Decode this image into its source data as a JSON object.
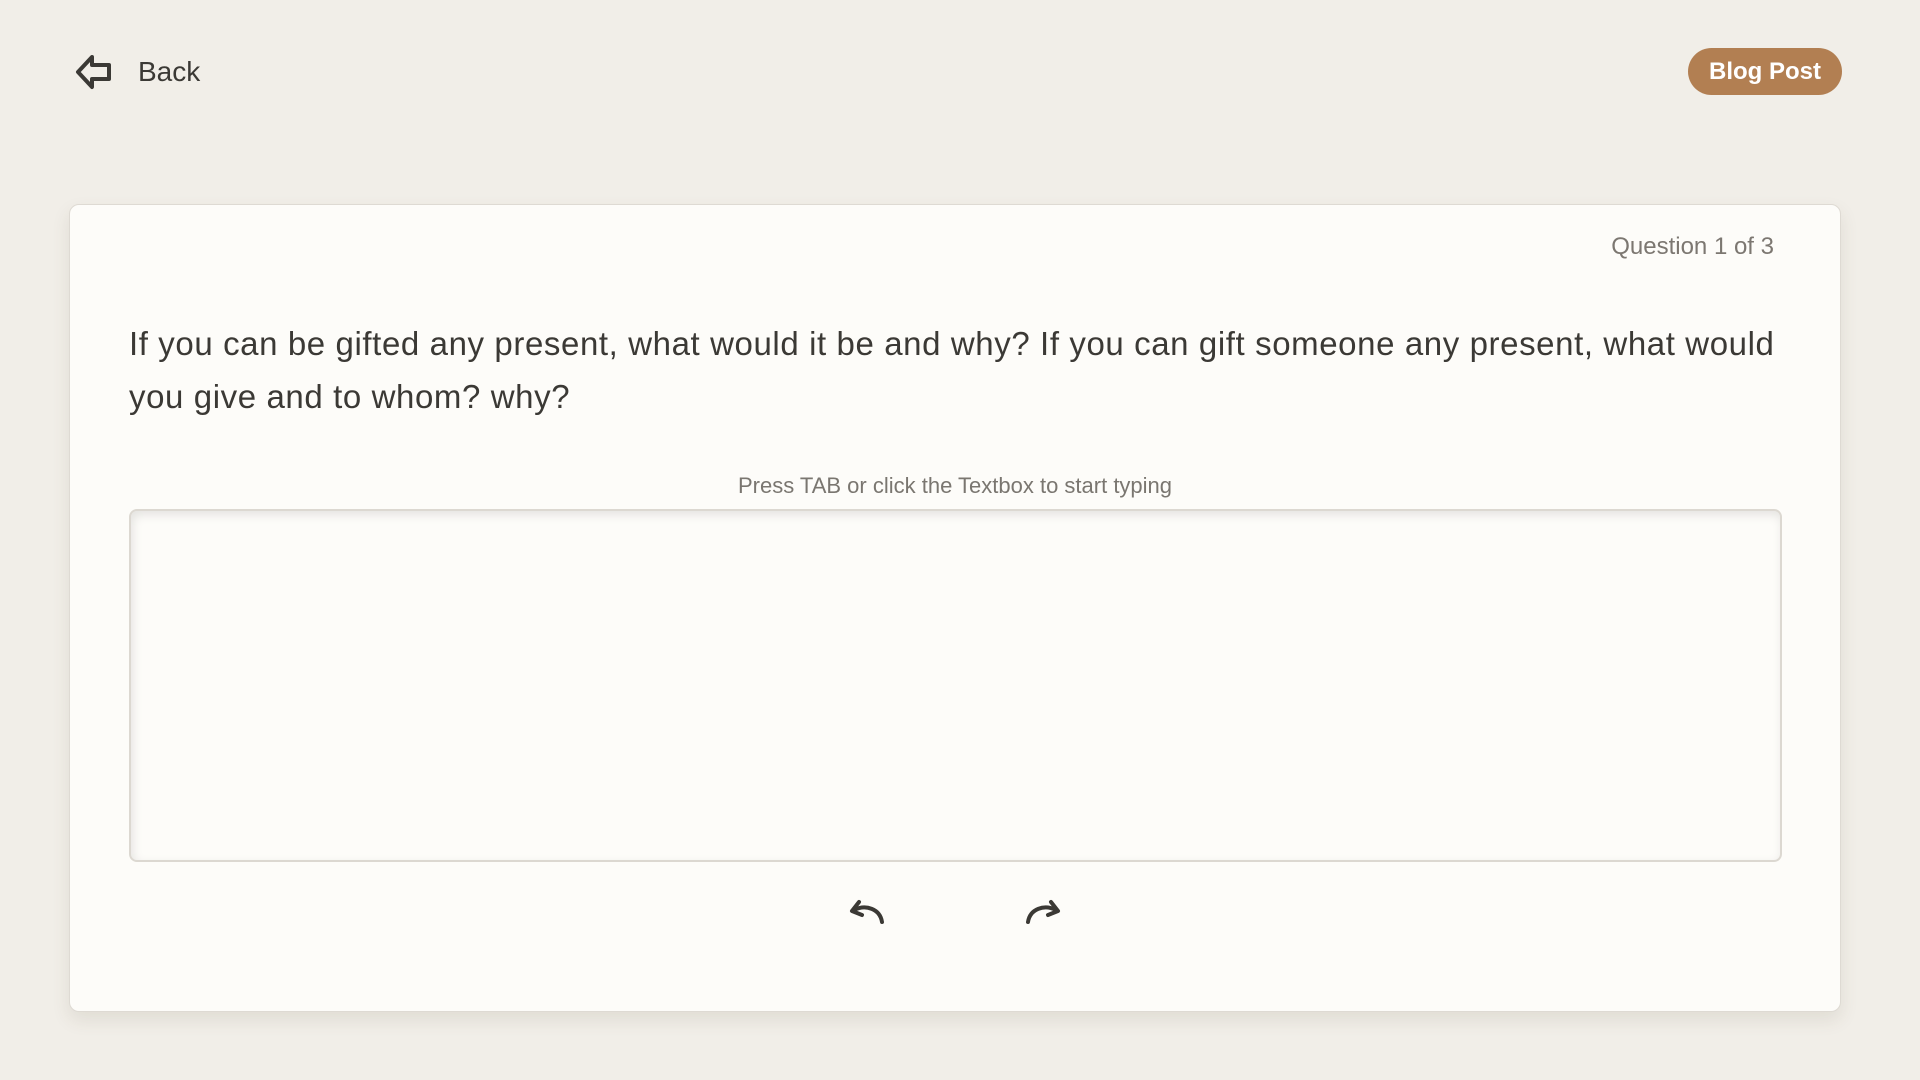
{
  "header": {
    "back_label": "Back",
    "badge_label": "Blog Post",
    "badge_color": "#b27f52"
  },
  "card": {
    "counter": "Question 1 of 3",
    "question": "If you can be gifted any present, what would it be and why? If you can gift someone any present, what would you give and to whom? why?",
    "hint": "Press TAB or click the Textbox to start typing",
    "answer_value": "",
    "answer_placeholder": ""
  },
  "icons": {
    "back": "back-arrow-icon",
    "undo": "undo-icon",
    "redo": "redo-icon"
  }
}
